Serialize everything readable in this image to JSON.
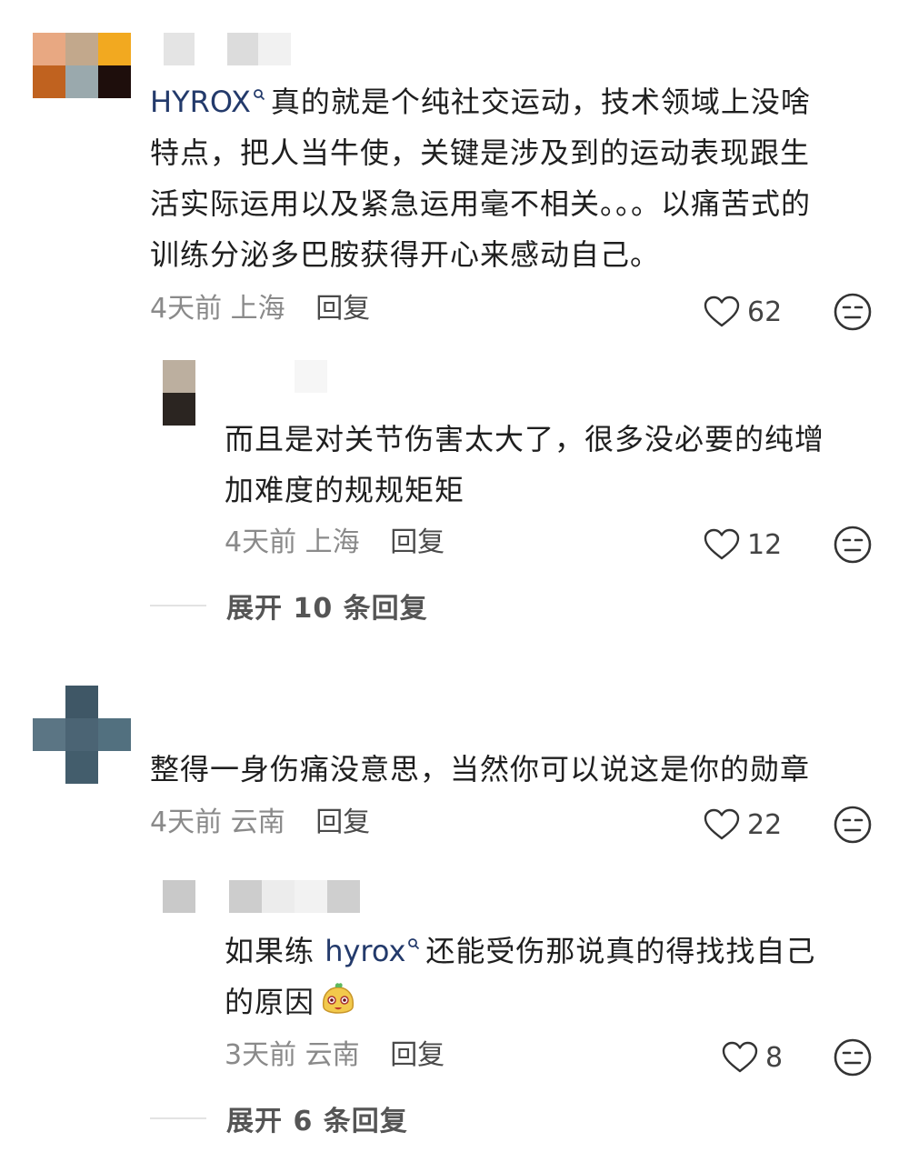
{
  "colors": {
    "keyword": "#233a6b",
    "meta": "#8a8a8a",
    "text": "#1f1f1f"
  },
  "comments": [
    {
      "text_keyword": "HYROX",
      "text_lines": [
        "真的就是个纯社交运动，技术领域上没啥",
        "特点，把人当牛使，关键是涉及到的运动表现跟生",
        "活实际运用以及紧急运用毫不相关。。。以痛苦式的",
        "训练分泌多巴胺获得开心来感动自己。"
      ],
      "time": "4天前",
      "location": "上海",
      "reply_label": "回复",
      "likes": "62",
      "replies": [
        {
          "text_lines": [
            "而且是对关节伤害太大了，很多没必要的纯增",
            "加难度的规规矩矩"
          ],
          "time": "4天前",
          "location": "上海",
          "reply_label": "回复",
          "likes": "12"
        }
      ],
      "expand_label": "展开 10 条回复"
    },
    {
      "text_lines": [
        "整得一身伤痛没意思，当然你可以说这是你的勋章"
      ],
      "time": "4天前",
      "location": "云南",
      "reply_label": "回复",
      "likes": "22",
      "replies": [
        {
          "text_prefix": "如果练 ",
          "text_keyword": "hyrox",
          "text_suffix": "还能受伤那说真的得找找自己",
          "text_line2": "的原因",
          "time": "3天前",
          "location": "云南",
          "reply_label": "回复",
          "likes": "8"
        }
      ],
      "expand_label": "展开 6 条回复"
    }
  ],
  "icons": {
    "search": "search-icon",
    "heart": "heart-icon",
    "dislike": "dislike-face-icon",
    "sticker": "sticker-emoji"
  }
}
